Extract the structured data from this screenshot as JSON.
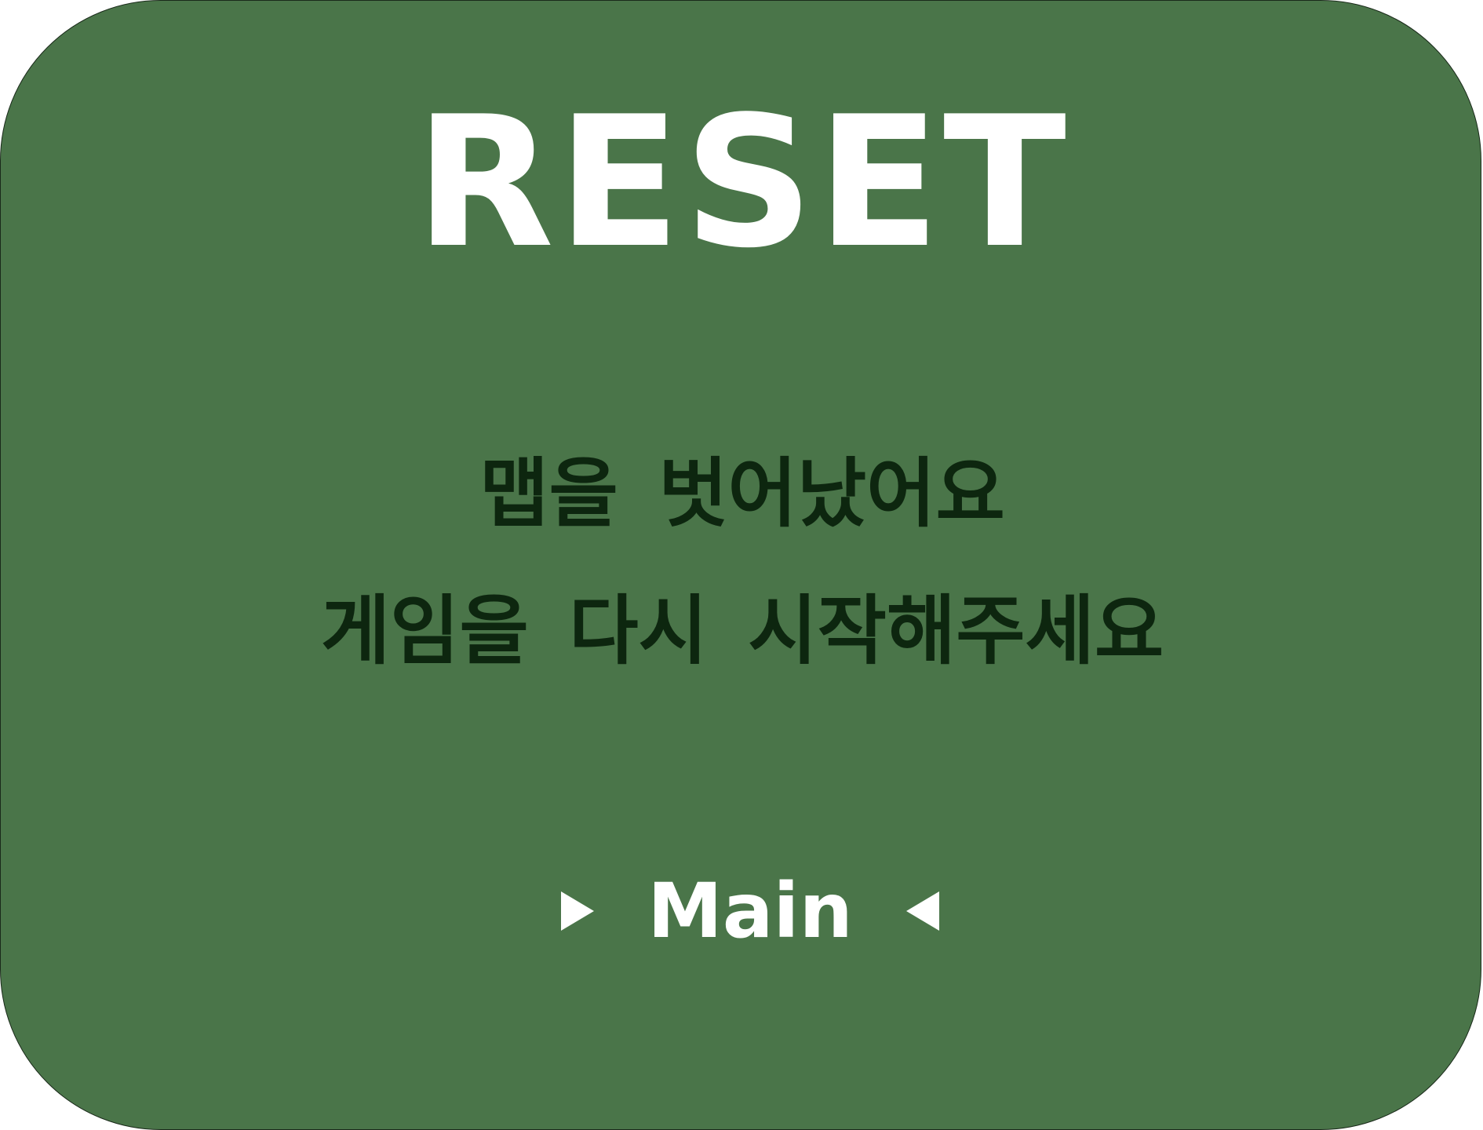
{
  "screen": {
    "title": "RESET",
    "message_line1": "맵을 벗어났어요",
    "message_line2": "게임을 다시 시작해주세요",
    "main_button_label": "Main"
  },
  "colors": {
    "panel_background": "#4a7549",
    "title_text": "#ffffff",
    "message_text": "#0d260f"
  },
  "icons": {
    "left_marker": "triangle-right-icon",
    "right_marker": "triangle-left-icon"
  }
}
